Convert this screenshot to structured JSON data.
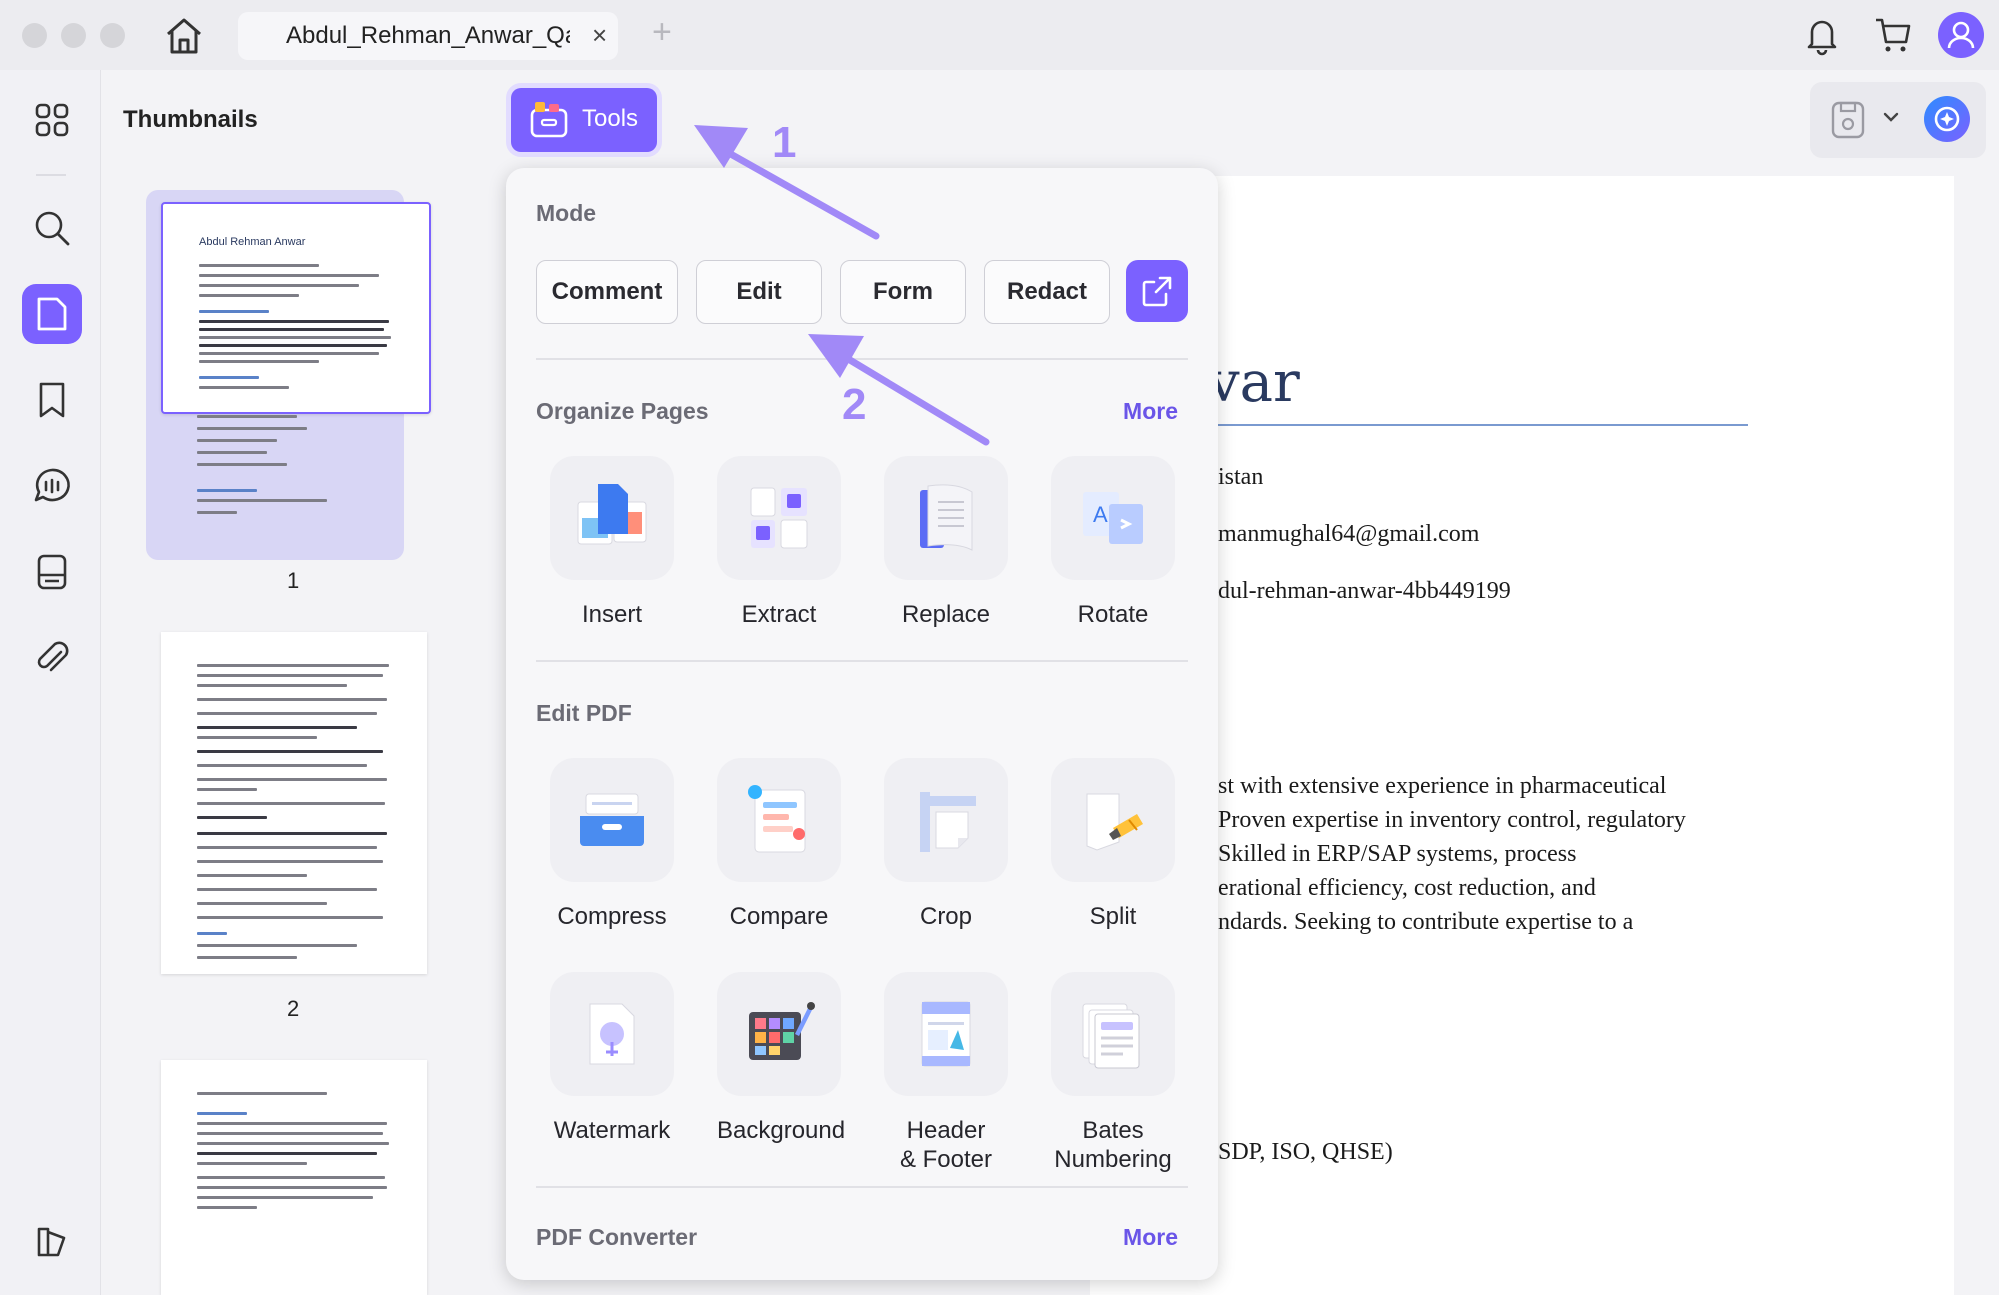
{
  "window": {
    "tab_title": "Abdul_Rehman_Anwar_Qa",
    "tab_close": "×",
    "tab_add": "+"
  },
  "thumbnails": {
    "title": "Thumbnails",
    "pages": [
      "1",
      "2"
    ],
    "page1_name": "Abdul Rehman Anwar"
  },
  "toolbar": {
    "tools_label": "Tools"
  },
  "tools_menu": {
    "mode": {
      "title": "Mode",
      "buttons": [
        "Comment",
        "Edit",
        "Form",
        "Redact"
      ]
    },
    "organize": {
      "title": "Organize Pages",
      "more": "More",
      "items": [
        "Insert",
        "Extract",
        "Replace",
        "Rotate"
      ]
    },
    "edit_pdf": {
      "title": "Edit PDF",
      "items": [
        "Compress",
        "Compare",
        "Crop",
        "Split",
        "Watermark",
        "Background",
        "Header\n& Footer",
        "Bates\nNumbering"
      ]
    },
    "converter": {
      "title": "PDF Converter",
      "more": "More"
    }
  },
  "annotations": {
    "one": "1",
    "two": "2"
  },
  "document": {
    "name_fragment": "var",
    "lines": [
      "istan",
      "manmughal64@gmail.com",
      "dul-rehman-anwar-4bb449199",
      "st with extensive experience in pharmaceutical",
      "Proven expertise in inventory control, regulatory",
      "Skilled in ERP/SAP systems, process",
      "erational efficiency, cost reduction, and",
      "ndards. Seeking to contribute expertise to a",
      "SDP, ISO, QHSE)"
    ]
  },
  "colors": {
    "accent": "#7b61ff",
    "more_link": "#6a55e8",
    "arrow": "#a189f7"
  }
}
